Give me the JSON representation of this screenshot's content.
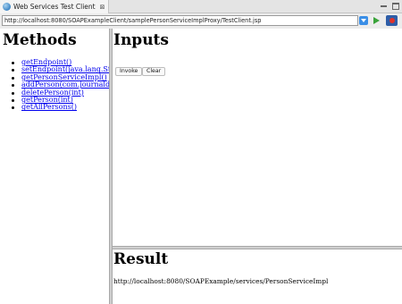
{
  "tab": {
    "title": "Web Services Test Client",
    "close_symbol": "⊠"
  },
  "address": {
    "url": "http://localhost:8080/SOAPExampleClient/samplePersonServiceImplProxy/TestClient.jsp"
  },
  "methods": {
    "heading": "Methods",
    "items": [
      "getEndpoint()",
      "setEndpoint(java.lang.String)",
      "getPersonServiceImpl()",
      "addPerson(com.journaldev.jaxws.beans.Person)",
      "deletePerson(int)",
      "getPerson(int)",
      "getAllPersons()"
    ]
  },
  "inputs": {
    "heading": "Inputs",
    "invoke_label": "Invoke",
    "clear_label": "Clear"
  },
  "result": {
    "heading": "Result",
    "text": "http://localhost:8080/SOAPExample/services/PersonServiceImpl"
  },
  "icons": {
    "tab": "globe-icon",
    "dropdown": "chevron-down-icon",
    "go": "play-icon",
    "nav": "browser-nav-icon"
  },
  "colors": {
    "link": "#0000ee",
    "accent": "#3a8ee6"
  }
}
